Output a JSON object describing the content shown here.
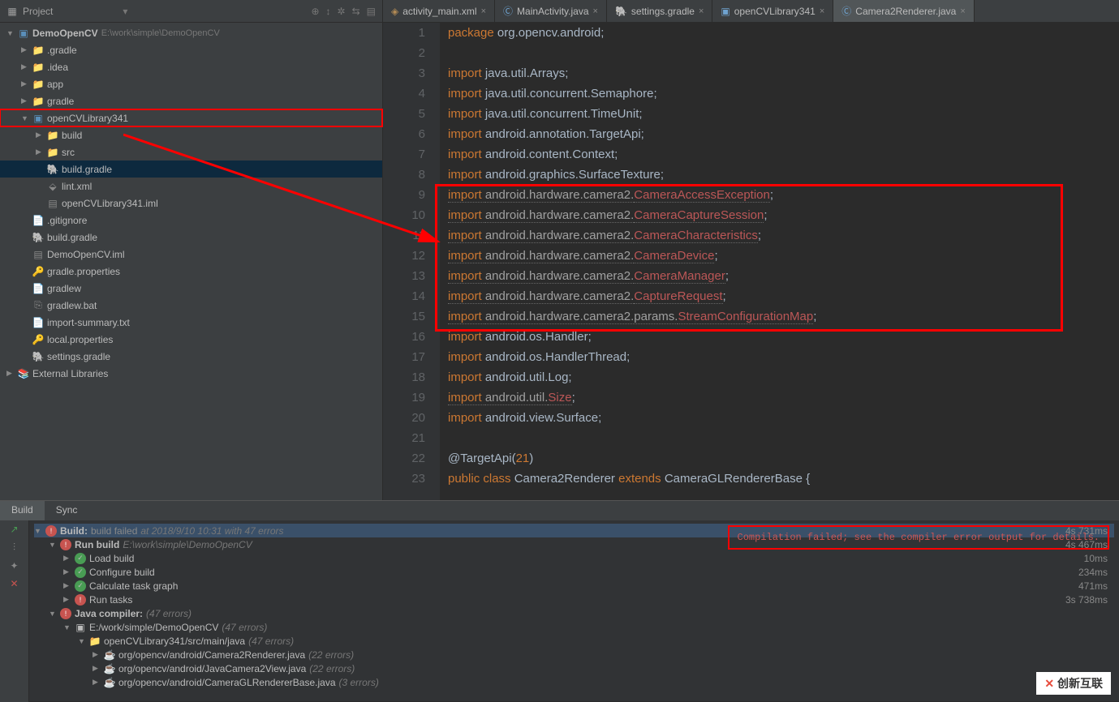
{
  "sidebar": {
    "title": "Project",
    "actions": [
      "⊕",
      "↕",
      "✲",
      "⇆",
      "▤"
    ],
    "root": {
      "name": "DemoOpenCV",
      "path": "E:\\work\\simple\\DemoOpenCV"
    },
    "items": [
      {
        "indent": 1,
        "arrow": "▶",
        "icon": "folder",
        "color": "yel",
        "label": ".gradle"
      },
      {
        "indent": 1,
        "arrow": "▶",
        "icon": "folder",
        "color": "",
        "label": ".idea"
      },
      {
        "indent": 1,
        "arrow": "▶",
        "icon": "folder",
        "color": "blue",
        "label": "app"
      },
      {
        "indent": 1,
        "arrow": "▶",
        "icon": "folder",
        "color": "",
        "label": "gradle"
      },
      {
        "indent": 1,
        "arrow": "▼",
        "icon": "module",
        "color": "blue",
        "label": "openCVLibrary341",
        "hl": true
      },
      {
        "indent": 2,
        "arrow": "▶",
        "icon": "folder",
        "color": "yel",
        "label": "build"
      },
      {
        "indent": 2,
        "arrow": "▶",
        "icon": "folder",
        "color": "blue",
        "label": "src"
      },
      {
        "indent": 2,
        "arrow": "",
        "icon": "gradle",
        "label": "build.gradle",
        "sel": true
      },
      {
        "indent": 2,
        "arrow": "",
        "icon": "xml",
        "label": "lint.xml"
      },
      {
        "indent": 2,
        "arrow": "",
        "icon": "iml",
        "label": "openCVLibrary341.iml"
      },
      {
        "indent": 1,
        "arrow": "",
        "icon": "file",
        "label": ".gitignore"
      },
      {
        "indent": 1,
        "arrow": "",
        "icon": "gradle",
        "label": "build.gradle"
      },
      {
        "indent": 1,
        "arrow": "",
        "icon": "iml",
        "label": "DemoOpenCV.iml"
      },
      {
        "indent": 1,
        "arrow": "",
        "icon": "prop",
        "label": "gradle.properties"
      },
      {
        "indent": 1,
        "arrow": "",
        "icon": "file",
        "label": "gradlew"
      },
      {
        "indent": 1,
        "arrow": "",
        "icon": "bat",
        "label": "gradlew.bat"
      },
      {
        "indent": 1,
        "arrow": "",
        "icon": "txt",
        "label": "import-summary.txt"
      },
      {
        "indent": 1,
        "arrow": "",
        "icon": "prop",
        "label": "local.properties"
      },
      {
        "indent": 1,
        "arrow": "",
        "icon": "gradle",
        "label": "settings.gradle"
      }
    ],
    "extlib": "External Libraries"
  },
  "tabs": [
    {
      "icon": "xml",
      "label": "activity_main.xml",
      "active": false
    },
    {
      "icon": "java",
      "label": "MainActivity.java",
      "active": false
    },
    {
      "icon": "gradle",
      "label": "settings.gradle",
      "active": false
    },
    {
      "icon": "module",
      "label": "openCVLibrary341",
      "active": false
    },
    {
      "icon": "java",
      "label": "Camera2Renderer.java",
      "active": true
    }
  ],
  "code": {
    "lines": [
      {
        "n": 1,
        "seg": [
          [
            "kw",
            "package "
          ],
          [
            " ",
            "org.opencv.android"
          ],
          [
            "",
            "; "
          ]
        ]
      },
      {
        "n": 2,
        "seg": [
          [
            "",
            ""
          ]
        ]
      },
      {
        "n": 3,
        "seg": [
          [
            "kw",
            "import "
          ],
          [
            " ",
            "java.util.Arrays"
          ],
          [
            "",
            "; "
          ]
        ]
      },
      {
        "n": 4,
        "seg": [
          [
            "kw",
            "import "
          ],
          [
            " ",
            "java.util.concurrent.Semaphore"
          ],
          [
            "",
            "; "
          ]
        ]
      },
      {
        "n": 5,
        "seg": [
          [
            "kw",
            "import "
          ],
          [
            " ",
            "java.util.concurrent.TimeUnit"
          ],
          [
            "",
            "; "
          ]
        ]
      },
      {
        "n": 6,
        "seg": [
          [
            "kw",
            "import "
          ],
          [
            " ",
            "android.annotation.TargetApi"
          ],
          [
            "",
            "; "
          ]
        ]
      },
      {
        "n": 7,
        "seg": [
          [
            "kw",
            "import "
          ],
          [
            " ",
            "android.content.Context"
          ],
          [
            "",
            "; "
          ]
        ]
      },
      {
        "n": 8,
        "seg": [
          [
            "kw",
            "import "
          ],
          [
            " ",
            "android.graphics.SurfaceTexture"
          ],
          [
            "",
            "; "
          ]
        ]
      },
      {
        "n": 9,
        "seg": [
          [
            "kw sq",
            "import "
          ],
          [
            " sq",
            "android.hardware.camera2."
          ],
          [
            "err sq",
            "CameraAccessException"
          ],
          [
            "",
            "; "
          ]
        ]
      },
      {
        "n": 10,
        "seg": [
          [
            "kw sq",
            "import "
          ],
          [
            " sq",
            "android.hardware.camera2."
          ],
          [
            "err sq",
            "CameraCaptureSession"
          ],
          [
            "",
            "; "
          ]
        ]
      },
      {
        "n": 11,
        "seg": [
          [
            "kw sq",
            "import "
          ],
          [
            " sq",
            "android.hardware.camera2."
          ],
          [
            "err sq",
            "CameraCharacteristics"
          ],
          [
            "",
            "; "
          ]
        ]
      },
      {
        "n": 12,
        "seg": [
          [
            "kw sq",
            "import "
          ],
          [
            " sq",
            "android.hardware.camera2."
          ],
          [
            "err sq",
            "CameraDevice"
          ],
          [
            "",
            "; "
          ]
        ]
      },
      {
        "n": 13,
        "seg": [
          [
            "kw sq",
            "import "
          ],
          [
            " sq",
            "android.hardware.camera2."
          ],
          [
            "err sq",
            "CameraManager"
          ],
          [
            "",
            "; "
          ]
        ]
      },
      {
        "n": 14,
        "seg": [
          [
            "kw sq",
            "import "
          ],
          [
            " sq",
            "android.hardware.camera2."
          ],
          [
            "err sq",
            "CaptureRequest"
          ],
          [
            "",
            "; "
          ]
        ]
      },
      {
        "n": 15,
        "seg": [
          [
            "kw sq",
            "import "
          ],
          [
            " sq",
            "android.hardware.camera2.params."
          ],
          [
            "err sq",
            "StreamConfigurationMap"
          ],
          [
            "",
            "; "
          ]
        ]
      },
      {
        "n": 16,
        "seg": [
          [
            "kw",
            "import "
          ],
          [
            " ",
            "android.os.Handler"
          ],
          [
            "",
            "; "
          ]
        ]
      },
      {
        "n": 17,
        "seg": [
          [
            "kw",
            "import "
          ],
          [
            " ",
            "android.os.HandlerThread"
          ],
          [
            "",
            "; "
          ]
        ]
      },
      {
        "n": 18,
        "seg": [
          [
            "kw",
            "import "
          ],
          [
            " ",
            "android.util.Log"
          ],
          [
            "",
            "; "
          ]
        ]
      },
      {
        "n": 19,
        "seg": [
          [
            "kw sq",
            "import "
          ],
          [
            " sq",
            "android.util."
          ],
          [
            "err sq",
            "Size"
          ],
          [
            "",
            "; "
          ]
        ]
      },
      {
        "n": 20,
        "seg": [
          [
            "kw",
            "import "
          ],
          [
            " ",
            "android.view.Surface"
          ],
          [
            "",
            "; "
          ]
        ]
      },
      {
        "n": 21,
        "seg": [
          [
            "",
            ""
          ]
        ]
      },
      {
        "n": 22,
        "seg": [
          [
            "",
            "@TargetApi("
          ],
          [
            "kw",
            "21"
          ],
          [
            "",
            ")"
          ]
        ]
      },
      {
        "n": 23,
        "seg": [
          [
            "kw",
            "public class "
          ],
          [
            " ",
            "Camera2Renderer "
          ],
          [
            "kw",
            "extends "
          ],
          [
            " ",
            "CameraGLRendererBase {"
          ]
        ]
      }
    ]
  },
  "bottom": {
    "tabs": [
      "Build",
      "Sync"
    ],
    "active": 0,
    "errorMsg": "Compilation failed; see the compiler error output for details.",
    "rows": [
      {
        "indent": 0,
        "arrow": "▼",
        "status": "err",
        "label": "Build:",
        "extra": "build failed",
        "meta": "at 2018/9/10 10:31   with 47 errors",
        "time": "4s 731ms",
        "bg": true
      },
      {
        "indent": 1,
        "arrow": "▼",
        "status": "err",
        "label": "Run build",
        "meta": "E:\\work\\simple\\DemoOpenCV",
        "time": "4s 467ms"
      },
      {
        "indent": 2,
        "arrow": "▶",
        "status": "ok",
        "label": "Load build",
        "time": "10ms"
      },
      {
        "indent": 2,
        "arrow": "▶",
        "status": "ok",
        "label": "Configure build",
        "time": "234ms"
      },
      {
        "indent": 2,
        "arrow": "▶",
        "status": "ok",
        "label": "Calculate task graph",
        "time": "471ms"
      },
      {
        "indent": 2,
        "arrow": "▶",
        "status": "err",
        "label": "Run tasks",
        "time": "3s 738ms"
      },
      {
        "indent": 1,
        "arrow": "▼",
        "status": "err",
        "label": "Java compiler:",
        "meta": "(47 errors)"
      },
      {
        "indent": 2,
        "arrow": "▼",
        "status": "",
        "icon": "mod",
        "label": "E:/work/simple/DemoOpenCV",
        "meta": "(47 errors)"
      },
      {
        "indent": 3,
        "arrow": "▼",
        "status": "",
        "icon": "fld",
        "label": "openCVLibrary341/src/main/java",
        "meta": "(47 errors)"
      },
      {
        "indent": 4,
        "arrow": "▶",
        "status": "",
        "icon": "java",
        "label": "org/opencv/android/Camera2Renderer.java",
        "meta": "(22 errors)"
      },
      {
        "indent": 4,
        "arrow": "▶",
        "status": "",
        "icon": "java",
        "label": "org/opencv/android/JavaCamera2View.java",
        "meta": "(22 errors)"
      },
      {
        "indent": 4,
        "arrow": "▶",
        "status": "",
        "icon": "java",
        "label": "org/opencv/android/CameraGLRendererBase.java",
        "meta": "(3 errors)"
      }
    ]
  },
  "watermark": "创新互联"
}
